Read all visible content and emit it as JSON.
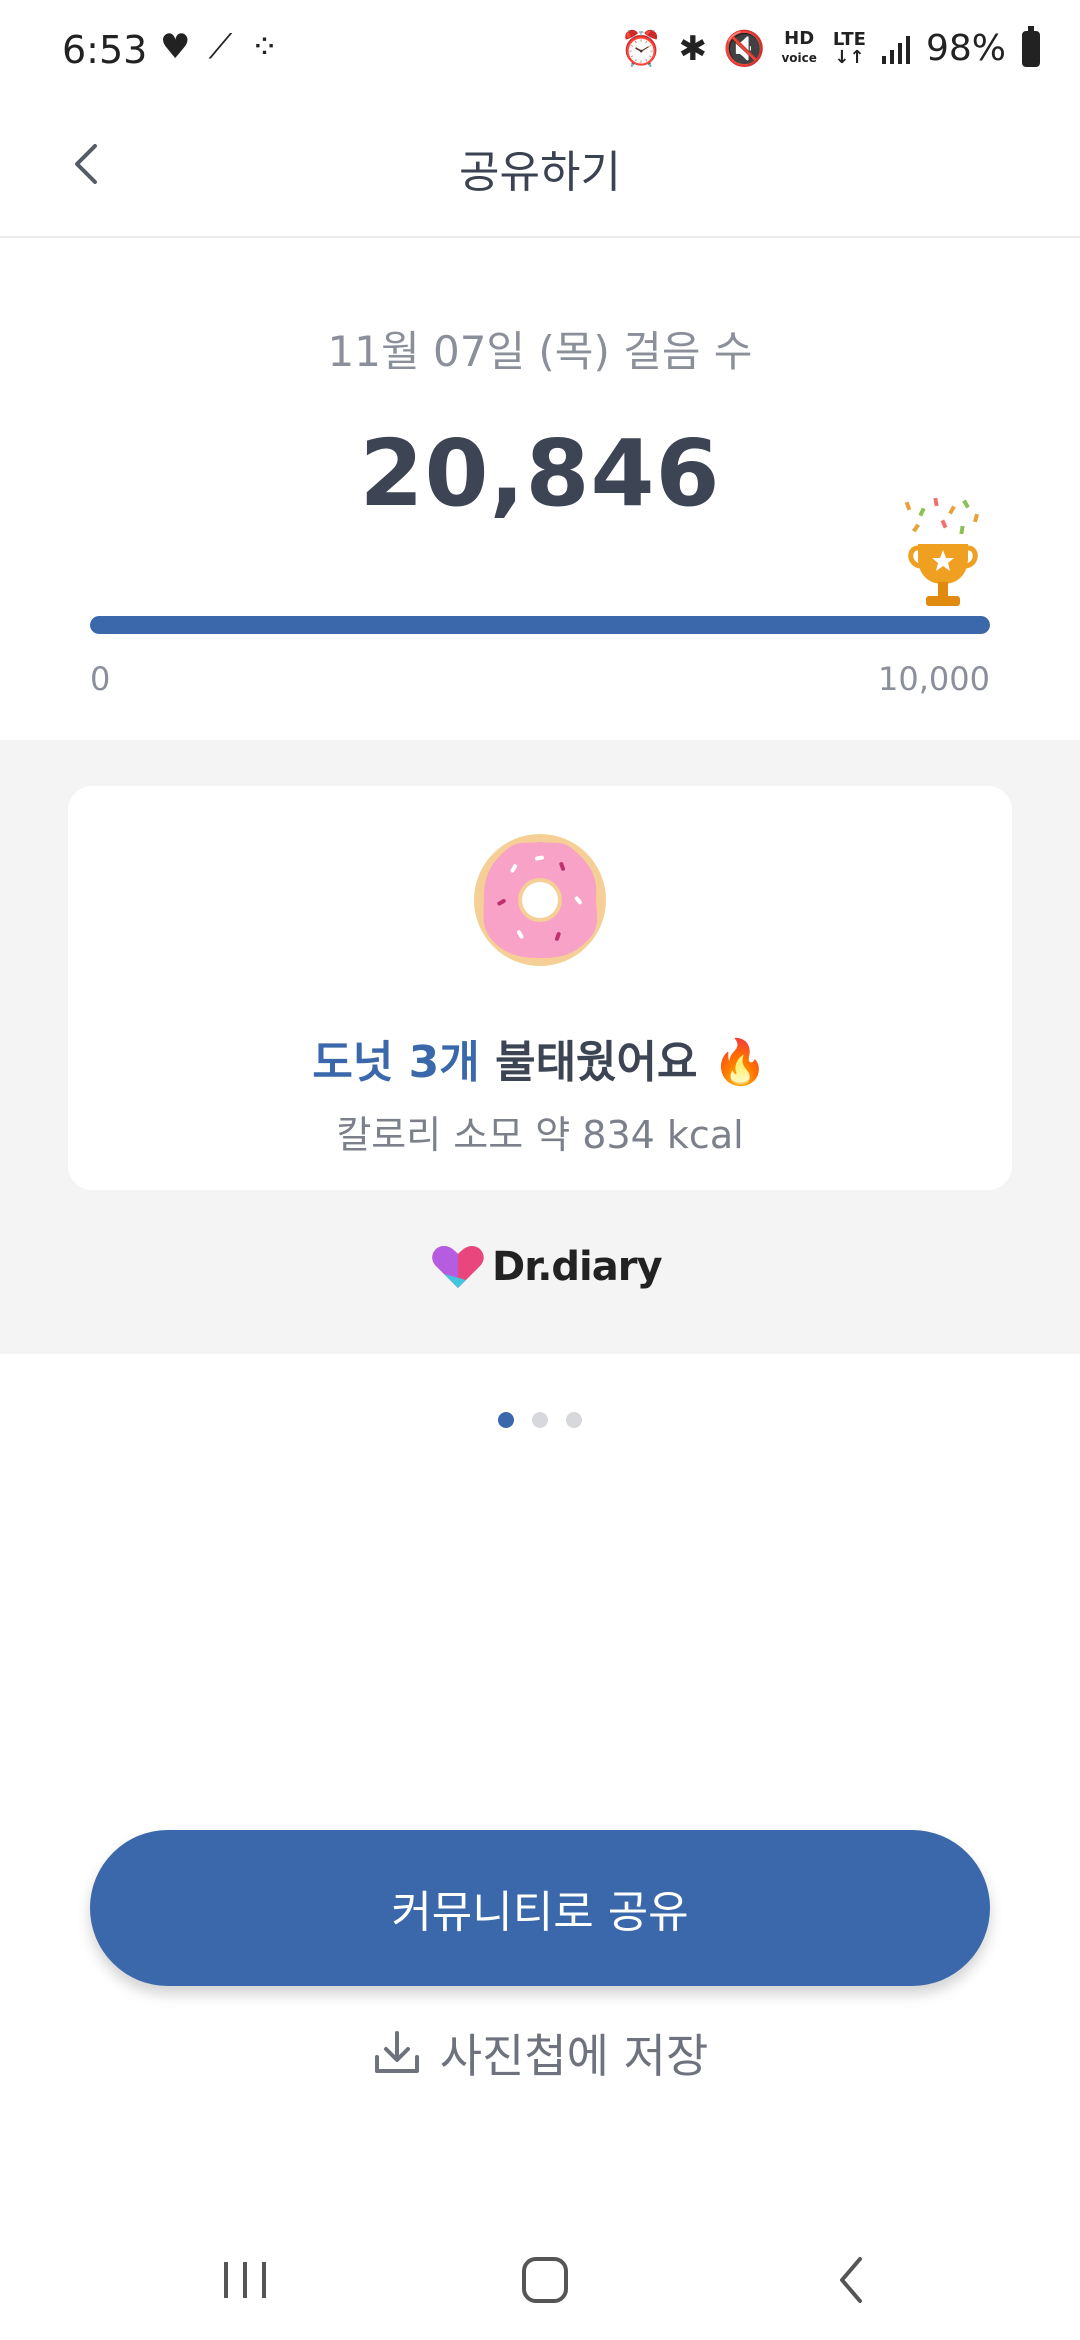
{
  "status_bar": {
    "time": "6:53",
    "battery": "98%",
    "icons": [
      "heart-rate-icon",
      "shoe-icon",
      "steps-icon",
      "alarm-icon",
      "bluetooth-icon",
      "mute-icon",
      "hd-voice-icon",
      "lte-icon",
      "signal-icon",
      "battery-icon"
    ],
    "hd_top": "HD",
    "hd_bottom": "voice",
    "lte": "LTE"
  },
  "header": {
    "title": "공유하기",
    "back_icon": "chevron-left-icon"
  },
  "steps": {
    "date_label": "11월 07일 (목) 걸음 수",
    "count": "20,846",
    "goal_min": "0",
    "goal_max": "10,000",
    "progress_fraction": 1.0
  },
  "card": {
    "burn_highlight": "도넛 3개",
    "burn_rest": " 불태웠어요 🔥",
    "calorie_text": "칼로리 소모 약 834 kcal",
    "brand": "Dr.diary"
  },
  "pager": {
    "count": 3,
    "active_index": 0
  },
  "actions": {
    "share_label": "커뮤니티로 공유",
    "save_label": "사진첩에 저장"
  },
  "colors": {
    "accent": "#3a68aa",
    "grey_bg": "#f4f4f4",
    "text_dark": "#3d4454",
    "text_muted": "#8a8f99"
  }
}
